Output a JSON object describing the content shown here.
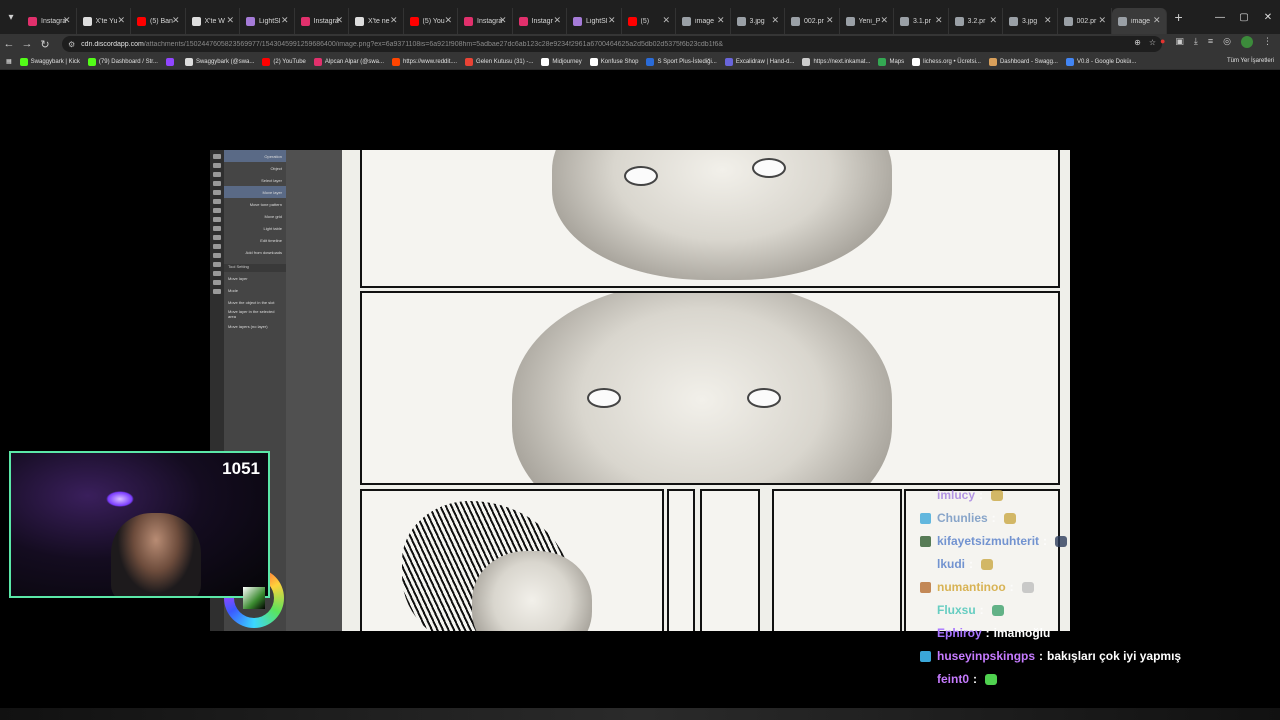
{
  "browser": {
    "tabs": [
      {
        "label": "Instagra",
        "icon": "instagram-icon",
        "color": "#e1306c"
      },
      {
        "label": "X'te Yu",
        "icon": "x-icon",
        "color": "#dddddd"
      },
      {
        "label": "(5) Ban",
        "icon": "youtube-icon",
        "color": "#ff0000"
      },
      {
        "label": "X'te W",
        "icon": "x-icon",
        "color": "#dddddd"
      },
      {
        "label": "LightSl",
        "icon": "lightshot-icon",
        "color": "#a57bd8"
      },
      {
        "label": "Instagra",
        "icon": "instagram-icon",
        "color": "#e1306c"
      },
      {
        "label": "X'te ne",
        "icon": "x-icon",
        "color": "#dddddd"
      },
      {
        "label": "(5) You",
        "icon": "youtube-icon",
        "color": "#ff0000"
      },
      {
        "label": "Instagra",
        "icon": "instagram-icon",
        "color": "#e1306c"
      },
      {
        "label": "Instagr",
        "icon": "instagram-icon",
        "color": "#e1306c"
      },
      {
        "label": "LightSl",
        "icon": "lightshot-icon",
        "color": "#a57bd8"
      },
      {
        "label": "(5)",
        "icon": "youtube-icon",
        "color": "#ff0000"
      },
      {
        "label": "image",
        "icon": "globe-icon",
        "color": "#9aa0a6"
      },
      {
        "label": "3.jpg",
        "icon": "globe-icon",
        "color": "#9aa0a6"
      },
      {
        "label": "002.pr",
        "icon": "globe-icon",
        "color": "#9aa0a6"
      },
      {
        "label": "Yeni_P",
        "icon": "globe-icon",
        "color": "#9aa0a6"
      },
      {
        "label": "3.1.pr",
        "icon": "globe-icon",
        "color": "#9aa0a6"
      },
      {
        "label": "3.2.pr",
        "icon": "globe-icon",
        "color": "#9aa0a6"
      },
      {
        "label": "3.jpg",
        "icon": "globe-icon",
        "color": "#9aa0a6"
      },
      {
        "label": "002.pr",
        "icon": "globe-icon",
        "color": "#9aa0a6"
      },
      {
        "label": "image",
        "icon": "globe-icon",
        "color": "#9aa0a6",
        "active": true
      }
    ],
    "url_host": "cdn.discordapp.com",
    "url_path": "/attachments/1502447605823569977/1543045991259686400/image.png?ex=6a9371108is=6a921f908hm=5adbae27dc6ab123c28e9234f2961a6700464625a2d5db02d5375f6b23cdb1f6&",
    "bookmarks": [
      {
        "label": "Swaggybark | Kick",
        "color": "#53fc18"
      },
      {
        "label": "(79) Dashboard / Str...",
        "color": "#53fc18"
      },
      {
        "label": "",
        "color": "#9146ff"
      },
      {
        "label": "Swaggybark (@swa...",
        "color": "#dddddd"
      },
      {
        "label": "(2) YouTube",
        "color": "#ff0000"
      },
      {
        "label": "Alpcan Alpar (@swa...",
        "color": "#e1306c"
      },
      {
        "label": "https://www.reddit....",
        "color": "#ff4500"
      },
      {
        "label": "Gelen Kutusu (31) -...",
        "color": "#ea4335"
      },
      {
        "label": "Midjourney",
        "color": "#ffffff"
      },
      {
        "label": "Konfuse Shop",
        "color": "#ffffff"
      },
      {
        "label": "S Sport Plus-İstediği...",
        "color": "#2a6bd8"
      },
      {
        "label": "Excalidraw | Hand-d...",
        "color": "#6965db"
      },
      {
        "label": "https://next.inkamat...",
        "color": "#cccccc"
      },
      {
        "label": "Maps",
        "color": "#34a853"
      },
      {
        "label": "lichess.org • Ücretsi...",
        "color": "#ffffff"
      },
      {
        "label": "Dashboard - Swagg...",
        "color": "#d9a05b"
      },
      {
        "label": "V0.8 - Google Doküı...",
        "color": "#4285f4"
      }
    ],
    "bookmarks_right": "Tüm Yer İşaretleri"
  },
  "csp_panel": {
    "rows": [
      "Operation",
      "Object",
      "Select layer",
      "Move layer",
      "Move tone pattern",
      "Move grid",
      "Light table",
      "Edit timeline",
      "Add from downloads"
    ],
    "sub_header": "Tool Setting",
    "sub_rows": [
      "Move layer",
      "Mode",
      "Move the object in the slot",
      "Move layer in the selected area",
      "Move layers (no layer)"
    ]
  },
  "webcam": {
    "viewer_count": "1051"
  },
  "chat": {
    "messages": [
      {
        "user": "imlucy",
        "user_color": "#a17be0",
        "badge_color": "",
        "text": "",
        "emote": "#c9a640",
        "faded": true
      },
      {
        "user": "Chunlies",
        "user_color": "#6a8fbf",
        "badge_color": "#3aa7d9",
        "text": "",
        "emote": "#c9a640",
        "faded": true
      },
      {
        "user": "kifayetsizmuhterit",
        "user_color": "#4e78c8",
        "badge_color": "#2b5a2b",
        "text": "",
        "emote": "#2a3a5a",
        "faded": true
      },
      {
        "user": "lkudi",
        "user_color": "#4e78c8",
        "badge_color": "",
        "text": "",
        "emote": "#c9a640",
        "faded": true
      },
      {
        "user": "numantinoo",
        "user_color": "#d0a22a",
        "badge_color": "#b56a2c",
        "text": "",
        "emote": "#bdbdbd",
        "faded": true
      },
      {
        "user": "Fluxsu",
        "user_color": "#3ec3b5",
        "badge_color": "",
        "text": "",
        "emote": "#3aa06a",
        "faded": true
      },
      {
        "user": "Ephiroy",
        "user_color": "#a874ff",
        "badge_color": "",
        "text": "imamoğlu",
        "emote": "",
        "faded": false
      },
      {
        "user": "huseyinpskingps",
        "user_color": "#c67bff",
        "badge_color": "#3aa7d9",
        "text": "bakışları çok iyi yapmış",
        "emote": "",
        "faded": false
      },
      {
        "user": "feint0",
        "user_color": "#c67bff",
        "badge_color": "",
        "text": "",
        "emote": "#4fd14f",
        "faded": false
      }
    ]
  }
}
